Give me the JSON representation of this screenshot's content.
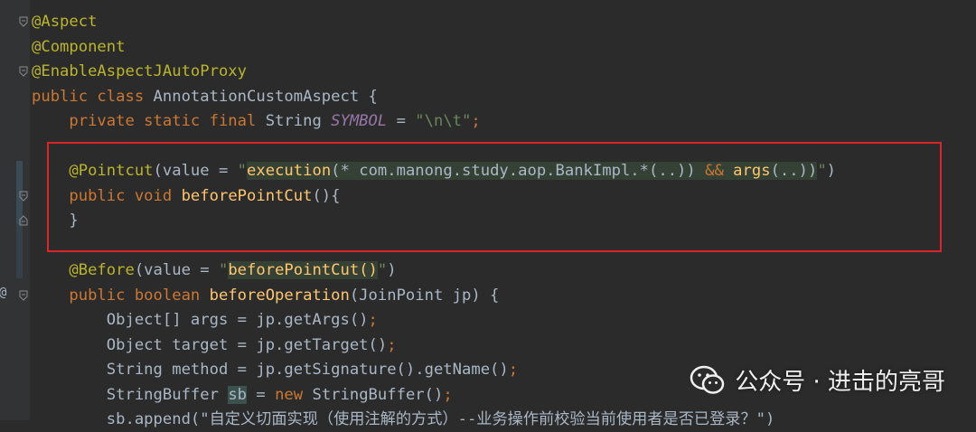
{
  "editor": {
    "code_lines": [
      [
        {
          "t": "@Aspect",
          "c": "ann"
        }
      ],
      [
        {
          "t": "@Component",
          "c": "ann"
        }
      ],
      [
        {
          "t": "@EnableAspectJAutoProxy",
          "c": "ann"
        }
      ],
      [
        {
          "t": "public class ",
          "c": "kw"
        },
        {
          "t": "AnnotationCustomAspect {",
          "c": "plain"
        }
      ],
      [
        {
          "t": "    private static final ",
          "c": "kw"
        },
        {
          "t": "String ",
          "c": "plain"
        },
        {
          "t": "SYMBOL",
          "c": "ital"
        },
        {
          "t": " = ",
          "c": "plain"
        },
        {
          "t": "\"\\n\\t\"",
          "c": "str"
        },
        {
          "t": ";",
          "c": "kw"
        }
      ],
      [],
      [
        {
          "t": "    @Pointcut",
          "c": "ann"
        },
        {
          "t": "(value = ",
          "c": "plain"
        },
        {
          "t": "\"",
          "c": "str"
        },
        {
          "t": "execution",
          "c": "inj-fn"
        },
        {
          "t": "(* com.manong.study.aop.BankImpl.*(..)) ",
          "c": "inj-plain"
        },
        {
          "t": "&&",
          "c": "inj-op"
        },
        {
          "t": " ",
          "c": "inj-plain"
        },
        {
          "t": "args",
          "c": "inj-fn"
        },
        {
          "t": "(..))",
          "c": "inj-plain"
        },
        {
          "t": "\"",
          "c": "str"
        },
        {
          "t": ")",
          "c": "plain"
        }
      ],
      [
        {
          "t": "    public void ",
          "c": "kw"
        },
        {
          "t": "beforePointCut",
          "c": "meth"
        },
        {
          "t": "(){",
          "c": "plain"
        }
      ],
      [
        {
          "t": "    }",
          "c": "plain"
        }
      ],
      [],
      [
        {
          "t": "    @Before",
          "c": "ann"
        },
        {
          "t": "(value = ",
          "c": "plain"
        },
        {
          "t": "\"",
          "c": "str"
        },
        {
          "t": "beforePointCut()",
          "c": "inj-fn"
        },
        {
          "t": "\"",
          "c": "str"
        },
        {
          "t": ")",
          "c": "plain"
        }
      ],
      [
        {
          "t": "    public boolean ",
          "c": "kw"
        },
        {
          "t": "beforeOperation",
          "c": "meth"
        },
        {
          "t": "(JoinPoint jp) {",
          "c": "plain"
        }
      ],
      [
        {
          "t": "        Object[] args = jp.getArgs()",
          "c": "plain"
        },
        {
          "t": ";",
          "c": "kw"
        }
      ],
      [
        {
          "t": "        Object target = jp.getTarget()",
          "c": "plain"
        },
        {
          "t": ";",
          "c": "kw"
        }
      ],
      [
        {
          "t": "        String method = jp.getSignature().getName()",
          "c": "plain"
        },
        {
          "t": ";",
          "c": "kw"
        }
      ],
      [
        {
          "t": "        StringBuffer ",
          "c": "plain"
        },
        {
          "t": "sb",
          "c": "var-hl"
        },
        {
          "t": " = ",
          "c": "plain"
        },
        {
          "t": "new ",
          "c": "kw"
        },
        {
          "t": "StringBuffer()",
          "c": "plain"
        },
        {
          "t": ";",
          "c": "kw"
        }
      ],
      [
        {
          "t": "        sb.append(\"自定义切面实现（使用注解的方式）--业务操作前校验当前使用者是否已登录？\")",
          "c": "plain"
        }
      ]
    ]
  },
  "watermark": {
    "text": "公众号 · 进击的亮哥"
  },
  "colors": {
    "background": "#2b2b2b",
    "keyword": "#cc7832",
    "annotation": "#bbb529",
    "string": "#6a8759",
    "highlight_box": "#d9262b"
  }
}
